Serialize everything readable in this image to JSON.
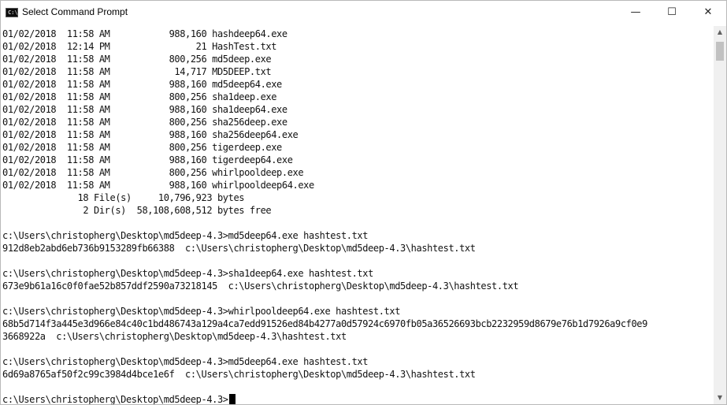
{
  "window": {
    "title": "Select Command Prompt",
    "icon_text": "C:\\",
    "controls": {
      "minimize": "—",
      "maximize": "☐",
      "close": "✕"
    }
  },
  "console": {
    "lines": [
      "01/02/2018  11:58 AM           988,160 hashdeep64.exe",
      "01/02/2018  12:14 PM                21 HashTest.txt",
      "01/02/2018  11:58 AM           800,256 md5deep.exe",
      "01/02/2018  11:58 AM            14,717 MD5DEEP.txt",
      "01/02/2018  11:58 AM           988,160 md5deep64.exe",
      "01/02/2018  11:58 AM           800,256 sha1deep.exe",
      "01/02/2018  11:58 AM           988,160 sha1deep64.exe",
      "01/02/2018  11:58 AM           800,256 sha256deep.exe",
      "01/02/2018  11:58 AM           988,160 sha256deep64.exe",
      "01/02/2018  11:58 AM           800,256 tigerdeep.exe",
      "01/02/2018  11:58 AM           988,160 tigerdeep64.exe",
      "01/02/2018  11:58 AM           800,256 whirlpooldeep.exe",
      "01/02/2018  11:58 AM           988,160 whirlpooldeep64.exe",
      "              18 File(s)     10,796,923 bytes",
      "               2 Dir(s)  58,108,608,512 bytes free",
      "",
      "c:\\Users\\christopherg\\Desktop\\md5deep-4.3>md5deep64.exe hashtest.txt",
      "912d8eb2abd6eb736b9153289fb66388  c:\\Users\\christopherg\\Desktop\\md5deep-4.3\\hashtest.txt",
      "",
      "c:\\Users\\christopherg\\Desktop\\md5deep-4.3>sha1deep64.exe hashtest.txt",
      "673e9b61a16c0f0fae52b857ddf2590a73218145  c:\\Users\\christopherg\\Desktop\\md5deep-4.3\\hashtest.txt",
      "",
      "c:\\Users\\christopherg\\Desktop\\md5deep-4.3>whirlpooldeep64.exe hashtest.txt",
      "68b5d714f3a445e3d966e84c40c1bd486743a129a4ca7edd91526ed84b4277a0d57924c6970fb05a36526693bcb2232959d8679e76b1d7926a9cf0e9",
      "3668922a  c:\\Users\\christopherg\\Desktop\\md5deep-4.3\\hashtest.txt",
      "",
      "c:\\Users\\christopherg\\Desktop\\md5deep-4.3>md5deep64.exe hashtest.txt",
      "6d69a8765af50f2c99c3984d4bce1e6f  c:\\Users\\christopherg\\Desktop\\md5deep-4.3\\hashtest.txt",
      ""
    ],
    "prompt": "c:\\Users\\christopherg\\Desktop\\md5deep-4.3>"
  },
  "scrollbar": {
    "up_arrow": "▲",
    "down_arrow": "▼"
  }
}
